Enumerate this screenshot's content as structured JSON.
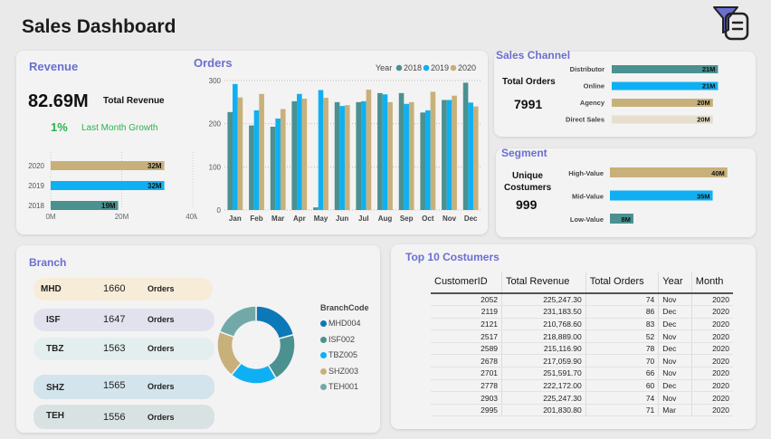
{
  "header": {
    "title": "Sales Dashboard"
  },
  "revenue": {
    "title": "Revenue",
    "total_value": "82.69M",
    "total_label": "Total Revenue",
    "growth_value": "1%",
    "growth_label": "Last Month Growth"
  },
  "orders": {
    "title": "Orders",
    "legend_title": "Year"
  },
  "sales_channel": {
    "title": "Sales Channel",
    "total_label": "Total Orders",
    "total_value": "7991"
  },
  "segment": {
    "title": "Segment",
    "unique_label_1": "Unique",
    "unique_label_2": "Costumers",
    "unique_value": "999"
  },
  "branch": {
    "title": "Branch",
    "legend_title": "BranchCode",
    "rows": [
      {
        "code": "MHD",
        "orders": "1660",
        "label": "Orders"
      },
      {
        "code": "ISF",
        "orders": "1647",
        "label": "Orders"
      },
      {
        "code": "TBZ",
        "orders": "1563",
        "label": "Orders"
      },
      {
        "code": "SHZ",
        "orders": "1565",
        "label": "Orders"
      },
      {
        "code": "TEH",
        "orders": "1556",
        "label": "Orders"
      }
    ]
  },
  "customers": {
    "title": "Top 10 Costumers",
    "columns": [
      "CustomerID",
      "Total Revenue",
      "Total Orders",
      "Year",
      "Month"
    ],
    "rows": [
      [
        "2052",
        "225,247.30",
        "74",
        "Nov",
        "2020"
      ],
      [
        "2119",
        "231,183.50",
        "86",
        "Dec",
        "2020"
      ],
      [
        "2121",
        "210,768.60",
        "83",
        "Dec",
        "2020"
      ],
      [
        "2517",
        "218,889.00",
        "52",
        "Nov",
        "2020"
      ],
      [
        "2589",
        "215,116.90",
        "78",
        "Dec",
        "2020"
      ],
      [
        "2678",
        "217,059.90",
        "70",
        "Nov",
        "2020"
      ],
      [
        "2701",
        "251,591.70",
        "66",
        "Nov",
        "2020"
      ],
      [
        "2778",
        "222,172.00",
        "60",
        "Dec",
        "2020"
      ],
      [
        "2903",
        "225,247.30",
        "74",
        "Nov",
        "2020"
      ],
      [
        "2995",
        "201,830.80",
        "71",
        "Mar",
        "2020"
      ]
    ]
  },
  "colors": {
    "y2018": "#4a9190",
    "y2019": "#0fb0f3",
    "y2020": "#c8b07a",
    "accent": "#6a6fd0",
    "light_bar": "#e6dfce"
  },
  "chart_data": [
    {
      "id": "revenue_by_year",
      "type": "bar",
      "orientation": "horizontal",
      "categories": [
        "2020",
        "2019",
        "2018"
      ],
      "values": [
        32,
        32,
        19
      ],
      "labels": [
        "32M",
        "32M",
        "19M"
      ],
      "colors": [
        "#c8b07a",
        "#0fb0f3",
        "#4a9190"
      ],
      "xticks": [
        "0M",
        "20M",
        "40M"
      ],
      "xlim": [
        0,
        40
      ]
    },
    {
      "id": "orders_by_month",
      "type": "bar",
      "title": "Orders",
      "categories": [
        "Jan",
        "Feb",
        "Mar",
        "Apr",
        "May",
        "Jun",
        "Jul",
        "Aug",
        "Sep",
        "Oct",
        "Nov",
        "Dec"
      ],
      "series": [
        {
          "name": "2018",
          "color": "#4a9190",
          "values": [
            227,
            196,
            193,
            252,
            6,
            250,
            250,
            271,
            271,
            226,
            255,
            295
          ]
        },
        {
          "name": "2019",
          "color": "#0fb0f3",
          "values": [
            292,
            231,
            212,
            269,
            278,
            241,
            252,
            268,
            246,
            231,
            255,
            249
          ]
        },
        {
          "name": "2020",
          "color": "#c8b07a",
          "values": [
            261,
            269,
            234,
            258,
            260,
            243,
            279,
            250,
            250,
            274,
            265,
            240
          ]
        }
      ],
      "yticks": [
        0,
        100,
        200,
        300
      ],
      "ylim": [
        0,
        300
      ],
      "legend": "top-right"
    },
    {
      "id": "sales_channel",
      "type": "bar",
      "orientation": "horizontal",
      "categories": [
        "Distributor",
        "Online",
        "Agency",
        "Direct Sales"
      ],
      "values": [
        21,
        21,
        20,
        20
      ],
      "labels": [
        "21M",
        "21M",
        "20M",
        "20M"
      ],
      "colors": [
        "#4a9190",
        "#0fb0f3",
        "#c8b07a",
        "#e6dfce"
      ],
      "xlim": [
        0,
        22
      ]
    },
    {
      "id": "segment",
      "type": "bar",
      "orientation": "horizontal",
      "categories": [
        "High-Value",
        "Mid-Value",
        "Low-Value"
      ],
      "values": [
        40,
        35,
        8
      ],
      "labels": [
        "40M",
        "35M",
        "8M"
      ],
      "colors": [
        "#c8b07a",
        "#0fb0f3",
        "#4a9190"
      ],
      "xlim": [
        0,
        41
      ]
    },
    {
      "id": "branch_donut",
      "type": "pie",
      "categories": [
        "MHD004",
        "ISF002",
        "TBZ005",
        "SHZ003",
        "TEH001"
      ],
      "values": [
        1660,
        1647,
        1563,
        1565,
        1556
      ],
      "colors": [
        "#0d78b8",
        "#4a9190",
        "#0fb0f3",
        "#c8b07a",
        "#72a9a8"
      ]
    }
  ]
}
